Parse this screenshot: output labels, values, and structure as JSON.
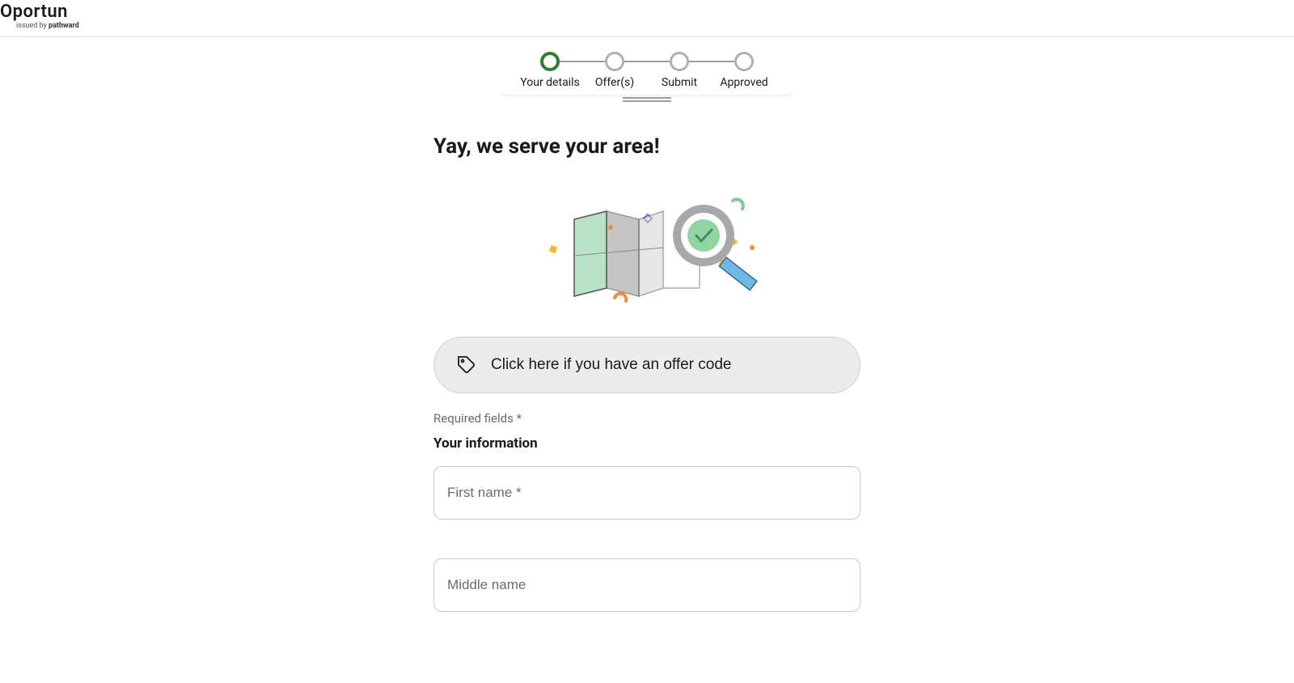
{
  "brand": {
    "name": "Oportun",
    "tagline_prefix": "issued by ",
    "tagline_brand": "pathward"
  },
  "stepper": {
    "steps": [
      {
        "label": "Your details",
        "active": true
      },
      {
        "label": "Offer(s)",
        "active": false
      },
      {
        "label": "Submit",
        "active": false
      },
      {
        "label": "Approved",
        "active": false
      }
    ]
  },
  "page": {
    "title": "Yay, we serve your area!"
  },
  "offer_code": {
    "label": "Click here if you have an offer code"
  },
  "form": {
    "required_note": "Required fields *",
    "section_title": "Your information",
    "first_name_placeholder": "First name *",
    "middle_name_placeholder": "Middle name"
  }
}
